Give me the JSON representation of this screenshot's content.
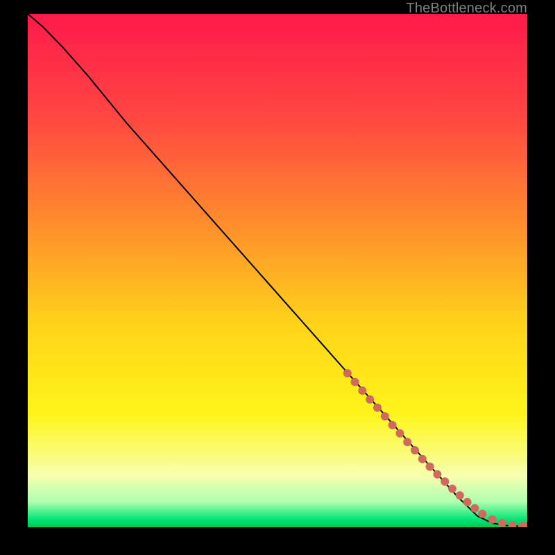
{
  "watermark": "TheBottleneck.com",
  "chart_data": {
    "type": "line",
    "title": "",
    "xlabel": "",
    "ylabel": "",
    "xlim": [
      0,
      100
    ],
    "ylim": [
      0,
      100
    ],
    "grid": false,
    "legend": false,
    "background_gradient": {
      "stops": [
        {
          "offset": 0.0,
          "color": "#ff1a4b"
        },
        {
          "offset": 0.2,
          "color": "#ff4642"
        },
        {
          "offset": 0.4,
          "color": "#ff8a2e"
        },
        {
          "offset": 0.6,
          "color": "#ffd21a"
        },
        {
          "offset": 0.78,
          "color": "#fff51a"
        },
        {
          "offset": 0.9,
          "color": "#f7ffb0"
        },
        {
          "offset": 0.95,
          "color": "#b0ffb0"
        },
        {
          "offset": 0.985,
          "color": "#00e676"
        },
        {
          "offset": 1.0,
          "color": "#00c853"
        }
      ]
    },
    "series": [
      {
        "name": "bottleneck-curve",
        "type": "line",
        "color": "#000000",
        "x": [
          0.0,
          3.0,
          7.0,
          12.0,
          20.0,
          30.0,
          40.0,
          50.0,
          60.0,
          70.0,
          80.0,
          86.0,
          90.0,
          93.0,
          96.0,
          98.0,
          100.0
        ],
        "values": [
          100.0,
          97.5,
          93.5,
          88.0,
          78.5,
          67.5,
          56.5,
          45.5,
          34.5,
          23.5,
          12.5,
          6.0,
          2.2,
          0.8,
          0.3,
          0.2,
          0.2
        ]
      },
      {
        "name": "highlight-points",
        "type": "scatter",
        "color": "#cf6a5d",
        "marker_radius_px": 6,
        "x": [
          64.0,
          65.5,
          67.0,
          68.5,
          70.0,
          71.5,
          73.0,
          74.5,
          76.0,
          77.5,
          79.0,
          80.5,
          82.0,
          83.5,
          85.0,
          86.5,
          88.0,
          89.5,
          91.0,
          93.0,
          95.0,
          97.0,
          99.0,
          100.0
        ],
        "values": [
          30.0,
          28.3,
          26.6,
          24.9,
          23.3,
          21.6,
          19.9,
          18.3,
          16.6,
          15.0,
          13.3,
          11.8,
          10.3,
          8.9,
          7.5,
          6.2,
          4.9,
          3.7,
          2.6,
          1.5,
          0.8,
          0.4,
          0.25,
          0.25
        ]
      }
    ]
  }
}
